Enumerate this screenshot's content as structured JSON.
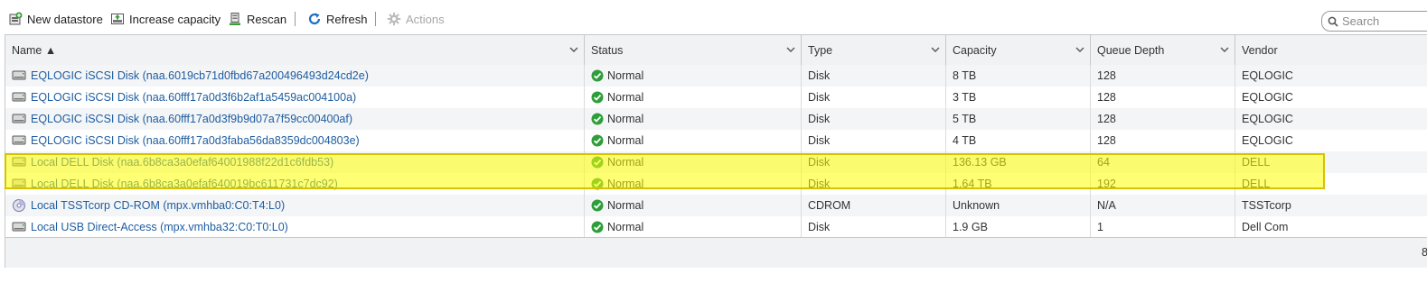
{
  "toolbar": {
    "new_datastore": "New datastore",
    "increase_capacity": "Increase capacity",
    "rescan": "Rescan",
    "refresh": "Refresh",
    "actions": "Actions"
  },
  "search": {
    "placeholder": "Search"
  },
  "columns": [
    "Name ▲",
    "Status",
    "Type",
    "Capacity",
    "Queue Depth",
    "Vendor"
  ],
  "rows": [
    {
      "name": "EQLOGIC iSCSI Disk (naa.6019cb71d0fbd67a200496493d24cd2e)",
      "status": "Normal",
      "type": "Disk",
      "capacity": "8 TB",
      "queue": "128",
      "vendor": "EQLOGIC",
      "icon": "disk-icon"
    },
    {
      "name": "EQLOGIC iSCSI Disk (naa.60fff17a0d3f6b2af1a5459ac004100a)",
      "status": "Normal",
      "type": "Disk",
      "capacity": "3 TB",
      "queue": "128",
      "vendor": "EQLOGIC",
      "icon": "disk-icon"
    },
    {
      "name": "EQLOGIC iSCSI Disk (naa.60fff17a0d3f9b9d07a7f59cc00400af)",
      "status": "Normal",
      "type": "Disk",
      "capacity": "5 TB",
      "queue": "128",
      "vendor": "EQLOGIC",
      "icon": "disk-icon"
    },
    {
      "name": "EQLOGIC iSCSI Disk (naa.60fff17a0d3faba56da8359dc004803e)",
      "status": "Normal",
      "type": "Disk",
      "capacity": "4 TB",
      "queue": "128",
      "vendor": "EQLOGIC",
      "icon": "disk-icon"
    },
    {
      "name": "Local DELL Disk (naa.6b8ca3a0efaf64001988f22d1c6fdb53)",
      "status": "Normal",
      "type": "Disk",
      "capacity": "136.13 GB",
      "queue": "64",
      "vendor": "DELL",
      "icon": "disk-icon"
    },
    {
      "name": "Local DELL Disk (naa.6b8ca3a0efaf640019bc611731c7dc92)",
      "status": "Normal",
      "type": "Disk",
      "capacity": "1.64 TB",
      "queue": "192",
      "vendor": "DELL",
      "icon": "disk-icon"
    },
    {
      "name": "Local TSSTcorp CD-ROM (mpx.vmhba0:C0:T4:L0)",
      "status": "Normal",
      "type": "CDROM",
      "capacity": "Unknown",
      "queue": "N/A",
      "vendor": "TSSTcorp",
      "icon": "cdrom-icon"
    },
    {
      "name": "Local USB Direct-Access (mpx.vmhba32:C0:T0:L0)",
      "status": "Normal",
      "type": "Disk",
      "capacity": "1.9 GB",
      "queue": "1",
      "vendor": "Dell Com",
      "icon": "disk-icon"
    }
  ],
  "footer": {
    "count": "8"
  },
  "colors": {
    "highlight": "#ffff00",
    "link": "#1f5da0",
    "ok": "#2e9e3a",
    "header_bg": "#f1f2f3"
  }
}
